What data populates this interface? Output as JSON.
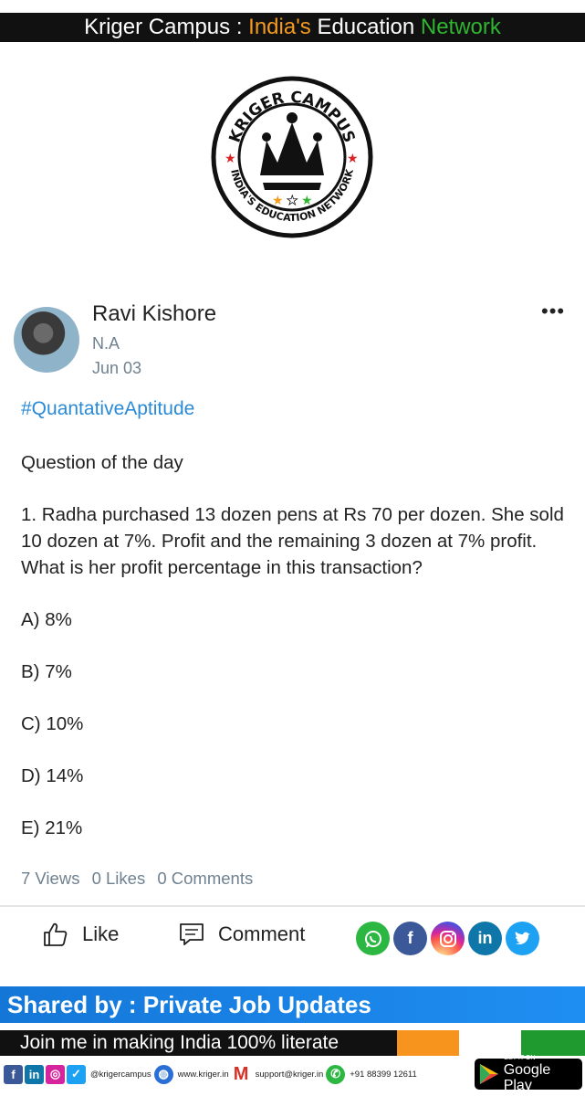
{
  "banner": {
    "part1": "Kriger Campus : ",
    "part2": "India's",
    "part3": " Education ",
    "part4": "Network"
  },
  "logo": {
    "top_text": "KRIGER CAMPUS",
    "bottom_text": "INDIA'S EDUCATION NETWORK"
  },
  "post": {
    "author": "Ravi Kishore",
    "subtitle": "N.A",
    "date": "Jun 03",
    "hashtag": "#QuantativeAptitude",
    "title": "Question of the day",
    "question": "1. Radha purchased 13 dozen pens at Rs 70 per dozen. She sold 10 dozen at 7%. Profit and the remaining 3 dozen at 7% profit. What is her profit percentage in this transaction?",
    "options": [
      "A) 8%",
      "B) 7%",
      "C) 10%",
      "D) 14%",
      "E) 21%"
    ],
    "views": "7 Views",
    "likes": "0 Likes",
    "comments": "0 Comments"
  },
  "actions": {
    "like_label": "Like",
    "comment_label": "Comment"
  },
  "share_icons": [
    "whatsapp-icon",
    "facebook-icon",
    "instagram-icon",
    "linkedin-icon",
    "twitter-icon"
  ],
  "footer": {
    "shared_by": "Shared by : Private Job Updates",
    "tagline": "Join me in making India 100% literate",
    "social_handle": "@krigercampus",
    "website": "www.kriger.in",
    "email": "support@kriger.in",
    "phone": "+91 88399 12611",
    "play_small": "GET IT ON",
    "play_big": "Google Play"
  },
  "colors": {
    "accent_blue": "#2b8ad6",
    "muted": "#6f8190",
    "orange": "#f39a1f",
    "green": "#2fb52f"
  }
}
